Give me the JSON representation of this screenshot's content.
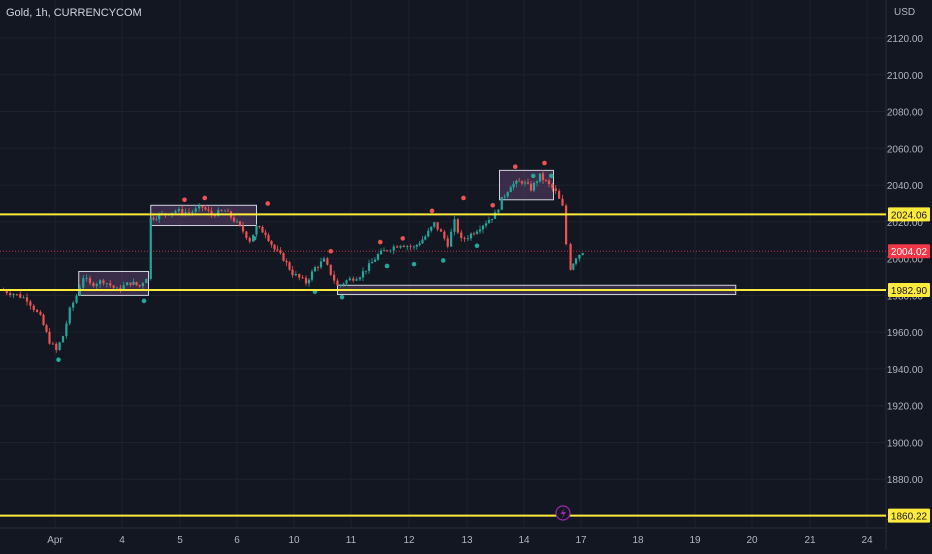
{
  "chart_data": {
    "type": "candlestick",
    "title": "Gold, 1h, CURRENCYCOM",
    "currency": "USD",
    "ylim": [
      1850,
      2138
    ],
    "xlim": [
      0,
      23.9
    ],
    "y_ticks": [
      1860,
      1880,
      1900,
      1920,
      1940,
      1960,
      1980,
      2000,
      2020,
      2040,
      2060,
      2080,
      2100,
      2120
    ],
    "y_tick_labels": [
      "1860.00",
      "1880.00",
      "1900.00",
      "1920.00",
      "1940.00",
      "1960.00",
      "1980.00",
      "2000.00",
      "2020.00",
      "2040.00",
      "2060.00",
      "2080.00",
      "2100.00",
      "2120.00"
    ],
    "x_ticks": [
      {
        "pos": 1.0,
        "label": "Apr"
      },
      {
        "pos": 4.0,
        "label": "4"
      },
      {
        "pos": 5.0,
        "label": "5"
      },
      {
        "pos": 6.0,
        "label": "6"
      },
      {
        "pos": 8.0,
        "label": "10"
      },
      {
        "pos": 9.0,
        "label": "11"
      },
      {
        "pos": 10.0,
        "label": "12"
      },
      {
        "pos": 11.0,
        "label": "13"
      },
      {
        "pos": 12.0,
        "label": "14"
      },
      {
        "pos": 13.0,
        "label": "17"
      },
      {
        "pos": 14.0,
        "label": "18"
      },
      {
        "pos": 15.0,
        "label": "19"
      },
      {
        "pos": 16.0,
        "label": "20"
      },
      {
        "pos": 17.0,
        "label": "21"
      },
      {
        "pos": 18.0,
        "label": "24"
      }
    ],
    "colors": {
      "up": "#26a69a",
      "down": "#ef5350",
      "level": "#ffeb3b",
      "zone_fill": "#5b3f6a",
      "zone_stroke": "#d1d4dc",
      "current_price": "#f23645"
    },
    "price_path": [
      [
        0.0,
        1983
      ],
      [
        0.3,
        1981
      ],
      [
        0.6,
        1978
      ],
      [
        0.9,
        1968
      ],
      [
        1.1,
        1955
      ],
      [
        1.25,
        1950
      ],
      [
        1.4,
        1958
      ],
      [
        1.55,
        1972
      ],
      [
        1.7,
        1980
      ],
      [
        1.85,
        1990
      ],
      [
        2.0,
        1986
      ],
      [
        2.3,
        1988
      ],
      [
        2.6,
        1983
      ],
      [
        2.9,
        1987
      ],
      [
        3.1,
        1985
      ],
      [
        3.25,
        1990
      ],
      [
        3.35,
        2022
      ],
      [
        3.6,
        2024
      ],
      [
        3.9,
        2026
      ],
      [
        4.2,
        2025
      ],
      [
        4.5,
        2028
      ],
      [
        4.7,
        2024
      ],
      [
        5.0,
        2026
      ],
      [
        5.2,
        2021
      ],
      [
        5.4,
        2015
      ],
      [
        5.55,
        2010
      ],
      [
        5.7,
        2017
      ],
      [
        5.9,
        2014
      ],
      [
        6.1,
        2005
      ],
      [
        6.3,
        2000
      ],
      [
        6.5,
        1992
      ],
      [
        6.8,
        1987
      ],
      [
        7.0,
        1995
      ],
      [
        7.2,
        1999
      ],
      [
        7.35,
        1992
      ],
      [
        7.5,
        1985
      ],
      [
        7.7,
        1988
      ],
      [
        8.0,
        1991
      ],
      [
        8.2,
        1996
      ],
      [
        8.4,
        2002
      ],
      [
        8.6,
        2005
      ],
      [
        8.9,
        2008
      ],
      [
        9.2,
        2006
      ],
      [
        9.45,
        2012
      ],
      [
        9.65,
        2019
      ],
      [
        9.8,
        2014
      ],
      [
        9.95,
        2008
      ],
      [
        10.1,
        2020
      ],
      [
        10.25,
        2010
      ],
      [
        10.4,
        2012
      ],
      [
        10.6,
        2016
      ],
      [
        10.8,
        2020
      ],
      [
        11.0,
        2024
      ],
      [
        11.15,
        2032
      ],
      [
        11.35,
        2040
      ],
      [
        11.6,
        2042
      ],
      [
        11.8,
        2038
      ],
      [
        12.0,
        2045
      ],
      [
        12.2,
        2040
      ],
      [
        12.35,
        2036
      ],
      [
        12.5,
        2028
      ],
      [
        12.58,
        2008
      ],
      [
        12.68,
        1995
      ],
      [
        12.8,
        2001
      ],
      [
        12.95,
        2004
      ]
    ],
    "levels": [
      {
        "value": 2024.06,
        "label": "2024.06"
      },
      {
        "value": 1982.9,
        "label": "1982.90"
      },
      {
        "value": 1860.22,
        "label": "1860.22"
      }
    ],
    "current_price": {
      "value": 2004.02,
      "label": "2004.02"
    },
    "zones": [
      {
        "x0": 1.75,
        "x1": 3.3,
        "y0": 1980,
        "y1": 1993
      },
      {
        "x0": 3.35,
        "x1": 5.7,
        "y0": 2018,
        "y1": 2029
      },
      {
        "x0": 7.5,
        "x1": 16.35,
        "y0": 1980.5,
        "y1": 1985.5
      },
      {
        "x0": 11.1,
        "x1": 12.3,
        "y0": 2032,
        "y1": 2048
      }
    ],
    "markers": [
      {
        "type": "down",
        "x": 1.3,
        "y": 1945
      },
      {
        "type": "down",
        "x": 3.2,
        "y": 1977
      },
      {
        "type": "up",
        "x": 4.1,
        "y": 2032
      },
      {
        "type": "up",
        "x": 4.55,
        "y": 2033
      },
      {
        "type": "up",
        "x": 5.95,
        "y": 2030
      },
      {
        "type": "down",
        "x": 5.65,
        "y": 2011
      },
      {
        "type": "down",
        "x": 7.0,
        "y": 1982
      },
      {
        "type": "up",
        "x": 7.35,
        "y": 2004
      },
      {
        "type": "down",
        "x": 7.6,
        "y": 1979
      },
      {
        "type": "up",
        "x": 8.45,
        "y": 2009
      },
      {
        "type": "down",
        "x": 8.6,
        "y": 1996
      },
      {
        "type": "up",
        "x": 8.95,
        "y": 2011
      },
      {
        "type": "down",
        "x": 9.2,
        "y": 1997
      },
      {
        "type": "up",
        "x": 9.6,
        "y": 2026
      },
      {
        "type": "down",
        "x": 9.85,
        "y": 1999
      },
      {
        "type": "up",
        "x": 10.3,
        "y": 2033
      },
      {
        "type": "down",
        "x": 10.6,
        "y": 2007
      },
      {
        "type": "up",
        "x": 10.95,
        "y": 2029
      },
      {
        "type": "up",
        "x": 11.45,
        "y": 2050
      },
      {
        "type": "down",
        "x": 11.85,
        "y": 2045
      },
      {
        "type": "up",
        "x": 12.1,
        "y": 2052
      },
      {
        "type": "down",
        "x": 12.25,
        "y": 2045
      }
    ]
  }
}
